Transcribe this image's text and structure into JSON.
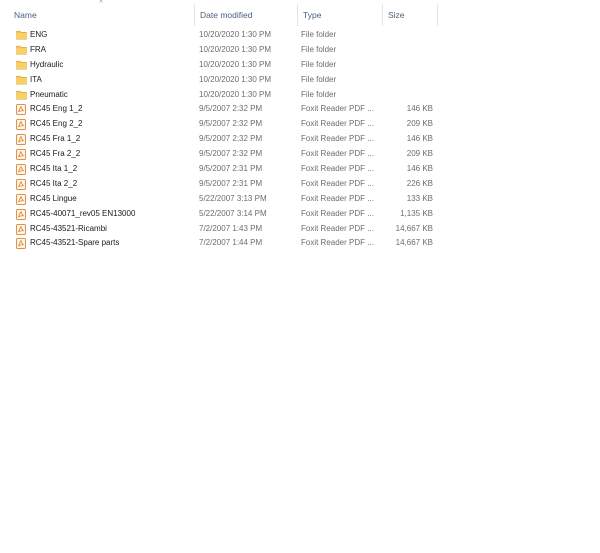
{
  "columns": {
    "name": "Name",
    "date": "Date modified",
    "type": "Type",
    "size": "Size"
  },
  "sort_indicator": "^",
  "colors": {
    "header_text": "#4c607a",
    "folder_yellow": "#f5c451",
    "pdf_orange": "#d9822b",
    "secondary_text": "#6d6d6d"
  },
  "files": [
    {
      "name": "ENG",
      "date": "10/20/2020 1:30 PM",
      "type": "File folder",
      "size": "",
      "icon": "folder-icon"
    },
    {
      "name": "FRA",
      "date": "10/20/2020 1:30 PM",
      "type": "File folder",
      "size": "",
      "icon": "folder-icon"
    },
    {
      "name": "Hydraulic",
      "date": "10/20/2020 1:30 PM",
      "type": "File folder",
      "size": "",
      "icon": "folder-icon"
    },
    {
      "name": "ITA",
      "date": "10/20/2020 1:30 PM",
      "type": "File folder",
      "size": "",
      "icon": "folder-icon"
    },
    {
      "name": "Pneumatic",
      "date": "10/20/2020 1:30 PM",
      "type": "File folder",
      "size": "",
      "icon": "folder-icon"
    },
    {
      "name": "RC45 Eng 1_2",
      "date": "9/5/2007 2:32 PM",
      "type": "Foxit Reader PDF ...",
      "size": "146 KB",
      "icon": "pdf-icon"
    },
    {
      "name": "RC45 Eng 2_2",
      "date": "9/5/2007 2:32 PM",
      "type": "Foxit Reader PDF ...",
      "size": "209 KB",
      "icon": "pdf-icon"
    },
    {
      "name": "RC45 Fra 1_2",
      "date": "9/5/2007 2:32 PM",
      "type": "Foxit Reader PDF ...",
      "size": "146 KB",
      "icon": "pdf-icon"
    },
    {
      "name": "RC45 Fra 2_2",
      "date": "9/5/2007 2:32 PM",
      "type": "Foxit Reader PDF ...",
      "size": "209 KB",
      "icon": "pdf-icon"
    },
    {
      "name": "RC45 Ita 1_2",
      "date": "9/5/2007 2:31 PM",
      "type": "Foxit Reader PDF ...",
      "size": "146 KB",
      "icon": "pdf-icon"
    },
    {
      "name": "RC45 Ita 2_2",
      "date": "9/5/2007 2:31 PM",
      "type": "Foxit Reader PDF ...",
      "size": "226 KB",
      "icon": "pdf-icon"
    },
    {
      "name": "RC45 Lingue",
      "date": "5/22/2007 3:13 PM",
      "type": "Foxit Reader PDF ...",
      "size": "133 KB",
      "icon": "pdf-icon"
    },
    {
      "name": "RC45-40071_rev05 EN13000",
      "date": "5/22/2007 3:14 PM",
      "type": "Foxit Reader PDF ...",
      "size": "1,135 KB",
      "icon": "pdf-icon"
    },
    {
      "name": "RC45-43521-Ricambi",
      "date": "7/2/2007 1:43 PM",
      "type": "Foxit Reader PDF ...",
      "size": "14,667 KB",
      "icon": "pdf-icon"
    },
    {
      "name": "RC45-43521-Spare parts",
      "date": "7/2/2007 1:44 PM",
      "type": "Foxit Reader PDF ...",
      "size": "14,667 KB",
      "icon": "pdf-icon"
    }
  ]
}
